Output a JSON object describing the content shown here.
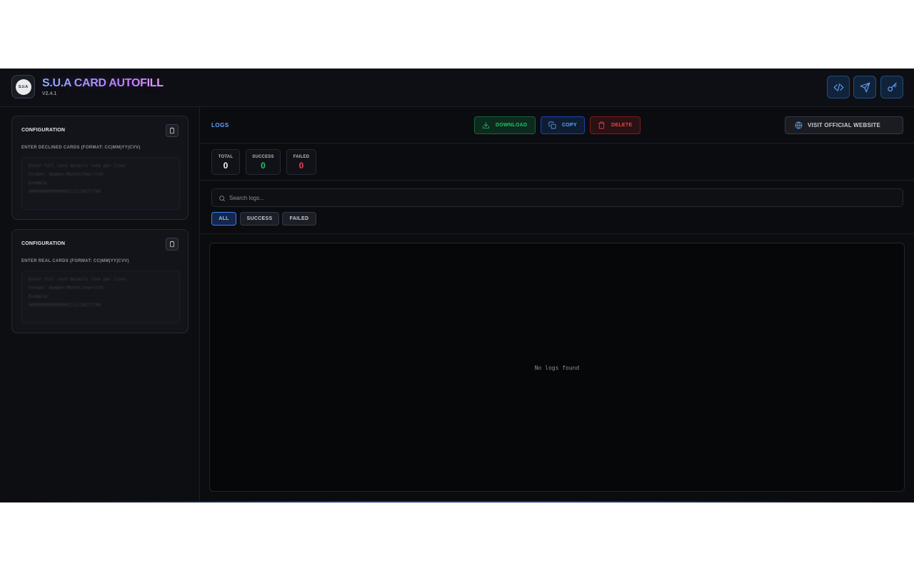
{
  "header": {
    "logo_text": "S.U.A",
    "title": "S.U.A CARD AUTOFILL",
    "version": "V2.4.1",
    "icons": [
      "code-icon",
      "send-icon",
      "key-icon"
    ]
  },
  "sidebar": {
    "cards": [
      {
        "title": "CONFIGURATION",
        "subtitle": "ENTER DECLINED CARDS (FORMAT: CC|MM|YY|CVV)",
        "placeholder": "Enter full card details (one per line)\nFormat: Number|Month|Year|CVV\nExample:\n4000000000000002|12|2027|746"
      },
      {
        "title": "CONFIGURATION",
        "subtitle": "ENTER REAL CARDS (FORMAT: CC|MM|YY|CVV)",
        "placeholder": "Enter full card details (one per line)\nFormat: Number|Month|Year|CVV\nExample:\n4000000000000002|12|2027|746"
      }
    ]
  },
  "logs": {
    "label": "LOGS",
    "download_label": "DOWNLOAD",
    "copy_label": "COPY",
    "delete_label": "DELETE",
    "website_label": "VISIT OFFICIAL WEBSITE",
    "stats": {
      "total_label": "TOTAL",
      "total_value": "0",
      "success_label": "SUCCESS",
      "success_value": "0",
      "failed_label": "FAILED",
      "failed_value": "0"
    },
    "search_placeholder": "Search logs...",
    "filters": {
      "all": "ALL",
      "success": "SUCCESS",
      "failed": "FAILED"
    },
    "empty_text": "No logs found"
  },
  "colors": {
    "accent": "#60a5fa",
    "success": "#22c55e",
    "danger": "#ef4444",
    "background": "#0b0c10"
  }
}
